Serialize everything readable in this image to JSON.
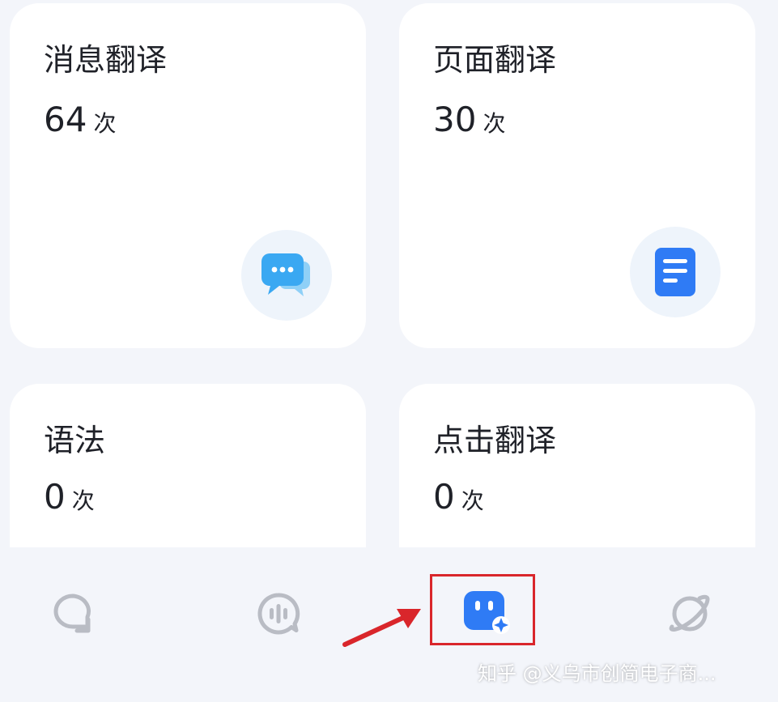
{
  "cards": [
    {
      "title": "消息翻译",
      "count": "64",
      "unit": "次",
      "icon": "chat-bubble-icon"
    },
    {
      "title": "页面翻译",
      "count": "30",
      "unit": "次",
      "icon": "document-icon"
    },
    {
      "title": "语法",
      "count": "0",
      "unit": "次"
    },
    {
      "title": "点击翻译",
      "count": "0",
      "unit": "次"
    }
  ],
  "bottom_nav": [
    {
      "icon": "chat-icon",
      "active": false
    },
    {
      "icon": "voice-icon",
      "active": false
    },
    {
      "icon": "ai-assistant-icon",
      "active": true
    },
    {
      "icon": "planet-icon",
      "active": false
    }
  ],
  "annotation": {
    "highlight_color": "#d9262b",
    "arrow_color": "#d9262b"
  },
  "watermark": "知乎 @义乌市创简电子商...",
  "colors": {
    "accent_blue": "#2f7bf5",
    "chat_icon_blue": "#3aa8f2",
    "nav_gray": "#b9bcc4"
  }
}
